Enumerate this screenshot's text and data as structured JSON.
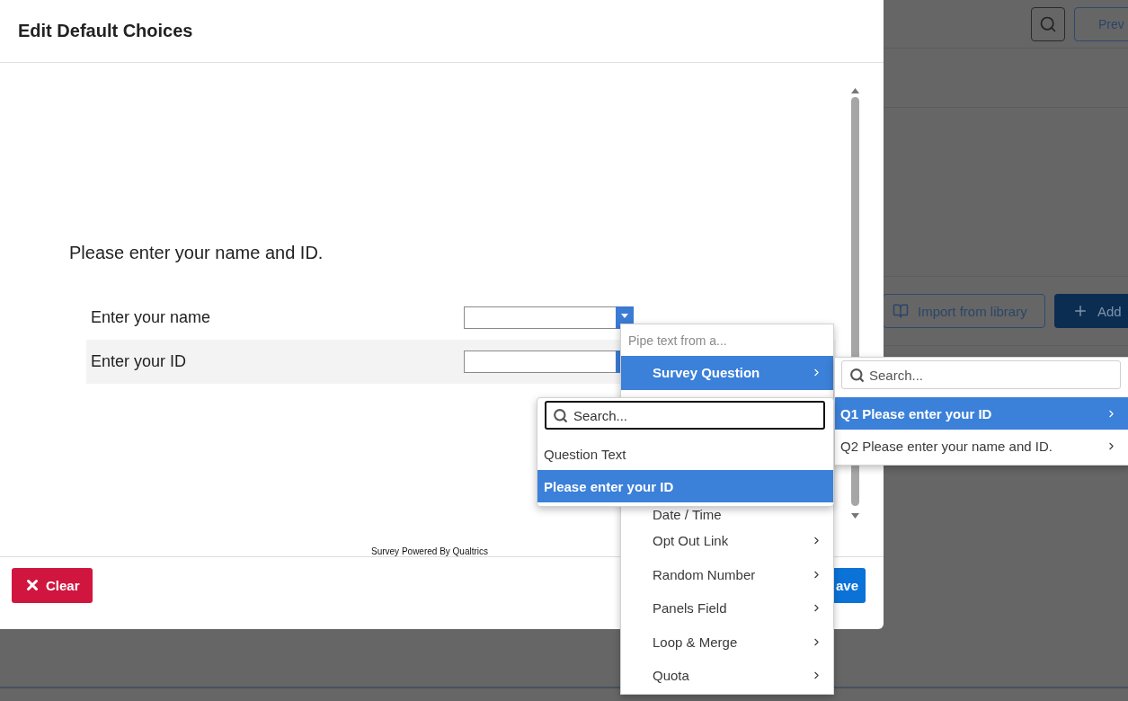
{
  "background_page": {
    "preview_button": "Prev",
    "import_button": "Import from library",
    "add_button": "Add"
  },
  "dialog": {
    "title": "Edit Default Choices",
    "question_text": "Please enter your name and ID.",
    "rows": [
      {
        "label": "Enter your name",
        "shaded": false
      },
      {
        "label": "Enter your ID",
        "shaded": true
      }
    ],
    "footer_text": "Survey Powered By Qualtrics",
    "buttons": [
      {
        "label": "Clear",
        "kind": "danger"
      },
      {
        "label": "ave",
        "kind": "primary"
      }
    ]
  },
  "pipe_menu": {
    "placeholder": "Pipe text from a...",
    "items": [
      {
        "label": "Survey Question",
        "selected": true,
        "has_submenu": true
      },
      {
        "label": "Date / Time",
        "selected": false,
        "has_submenu": false
      },
      {
        "label": "Opt Out Link",
        "selected": false,
        "has_submenu": true
      },
      {
        "label": "Random Number",
        "selected": false,
        "has_submenu": true
      },
      {
        "label": "Panels Field",
        "selected": false,
        "has_submenu": true
      },
      {
        "label": "Loop & Merge",
        "selected": false,
        "has_submenu": true
      },
      {
        "label": "Quota",
        "selected": false,
        "has_submenu": true
      }
    ]
  },
  "question_submenu": {
    "search_placeholder": "Search...",
    "items": [
      {
        "label": "Q1 Please enter your ID",
        "selected": true
      },
      {
        "label": "Q2 Please enter your name and ID.",
        "selected": false
      }
    ]
  },
  "field_popup": {
    "search_placeholder": "Search...",
    "search_focused": true,
    "items": [
      {
        "label": "Question Text",
        "selected": false
      },
      {
        "label": "Please enter your ID",
        "selected": true
      }
    ]
  }
}
